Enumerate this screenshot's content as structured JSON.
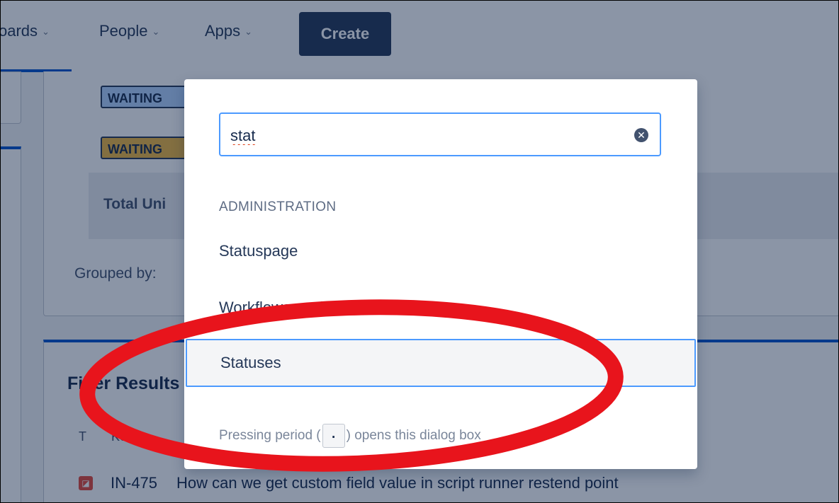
{
  "nav": {
    "boards_label": "oards",
    "people_label": "People",
    "apps_label": "Apps",
    "chevron": "⌄",
    "create_label": "Create"
  },
  "background": {
    "status_waiting_1": "WAITING",
    "status_waiting_2": "WAITING",
    "total_label": "Total Uni",
    "grouped_label": "Grouped by:",
    "filter_results_title": "Filter Results",
    "col_type": "T",
    "col_key": "Ke",
    "issue_key": "IN-475",
    "issue_summary": "How can we get custom field value in script runner restend point"
  },
  "dialog": {
    "search_value": "stat",
    "clear_glyph": "✕",
    "section_heading": "ADMINISTRATION",
    "results": [
      {
        "label": "Statuspage"
      },
      {
        "label": "Workflows workflow statuses"
      },
      {
        "label": "Statuses"
      }
    ],
    "footer_prefix": "Pressing period (",
    "footer_key": ".",
    "footer_suffix": ") opens this dialog box"
  },
  "colors": {
    "accent": "#4c9aff",
    "nav_dark": "#253858",
    "annotation_red": "#e8141c"
  }
}
